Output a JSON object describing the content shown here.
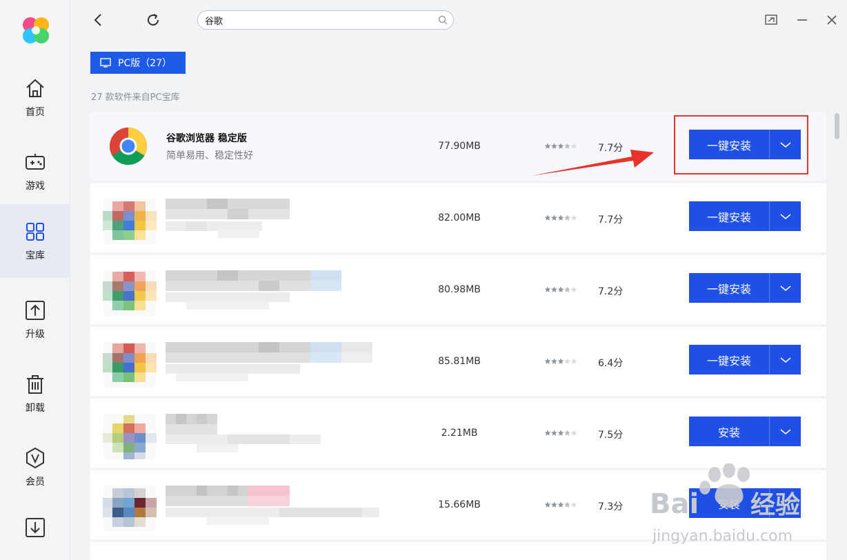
{
  "sidebar": {
    "items": [
      {
        "label": "首页",
        "icon": "home-icon",
        "active": false
      },
      {
        "label": "游戏",
        "icon": "gamepad-icon",
        "active": false
      },
      {
        "label": "宝库",
        "icon": "grid-icon",
        "active": true
      },
      {
        "label": "升级",
        "icon": "upgrade-icon",
        "active": false
      },
      {
        "label": "卸载",
        "icon": "trash-icon",
        "active": false
      },
      {
        "label": "会员",
        "icon": "vip-icon",
        "active": false
      },
      {
        "label": "",
        "icon": "download-icon",
        "active": false
      }
    ]
  },
  "search": {
    "value": "谷歌"
  },
  "tabs": {
    "pc_label": "PC版（27）"
  },
  "result_count_text": "27 款软件来自PC宝库",
  "apps": [
    {
      "name": "谷歌浏览器 稳定版",
      "desc": "简单易用、稳定性好",
      "size": "77.90MB",
      "rating": 3.5,
      "score": "7.7分",
      "button": "一键安装",
      "highlight": true
    },
    {
      "name": "",
      "desc": "",
      "size": "82.00MB",
      "rating": 3.5,
      "score": "7.7分",
      "button": "一键安装",
      "highlight": false
    },
    {
      "name": "",
      "desc": "",
      "size": "80.98MB",
      "rating": 3.5,
      "score": "7.2分",
      "button": "一键安装",
      "highlight": false
    },
    {
      "name": "",
      "desc": "",
      "size": "85.81MB",
      "rating": 3,
      "score": "6.4分",
      "button": "一键安装",
      "highlight": false
    },
    {
      "name": "",
      "desc": "",
      "size": "2.21MB",
      "rating": 3.5,
      "score": "7.5分",
      "button": "安装",
      "highlight": false
    },
    {
      "name": "",
      "desc": "",
      "size": "15.66MB",
      "rating": 3.5,
      "score": "7.3分",
      "button": "安装",
      "highlight": false
    }
  ],
  "colors": {
    "accent": "#1e4fe6",
    "annotation": "#e8322c",
    "sidebar_active": "#e6ebf3"
  },
  "watermark": {
    "brand_a": "Bai",
    "brand_b": "经验",
    "url": "jingyan.baidu.com"
  }
}
